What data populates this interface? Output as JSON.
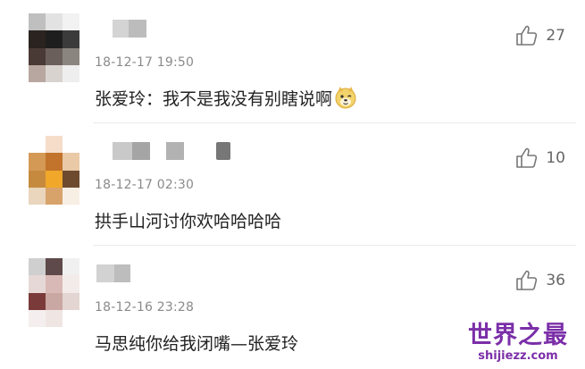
{
  "comments": [
    {
      "timestamp": "18-12-17 19:50",
      "text": "张爱玲：我不是我没有别瞎说啊",
      "like_count": "27",
      "emoji": "doge-emoji"
    },
    {
      "timestamp": "18-12-17 02:30",
      "text": "拱手山河讨你欢哈哈哈哈",
      "like_count": "10"
    },
    {
      "timestamp": "18-12-16 23:28",
      "text": "马思纯你给我闭嘴—张爱玲",
      "like_count": "36"
    }
  ],
  "watermark": {
    "title": "世界之最",
    "url": "shijiezz.com"
  },
  "colors": {
    "watermark": "#7b2fa8",
    "meta_text": "#8a8a8a",
    "body_text": "#222222"
  },
  "icons": {
    "like": "thumbs-up-icon",
    "avatar": "pixelated-avatar",
    "username": "pixelated-username"
  }
}
